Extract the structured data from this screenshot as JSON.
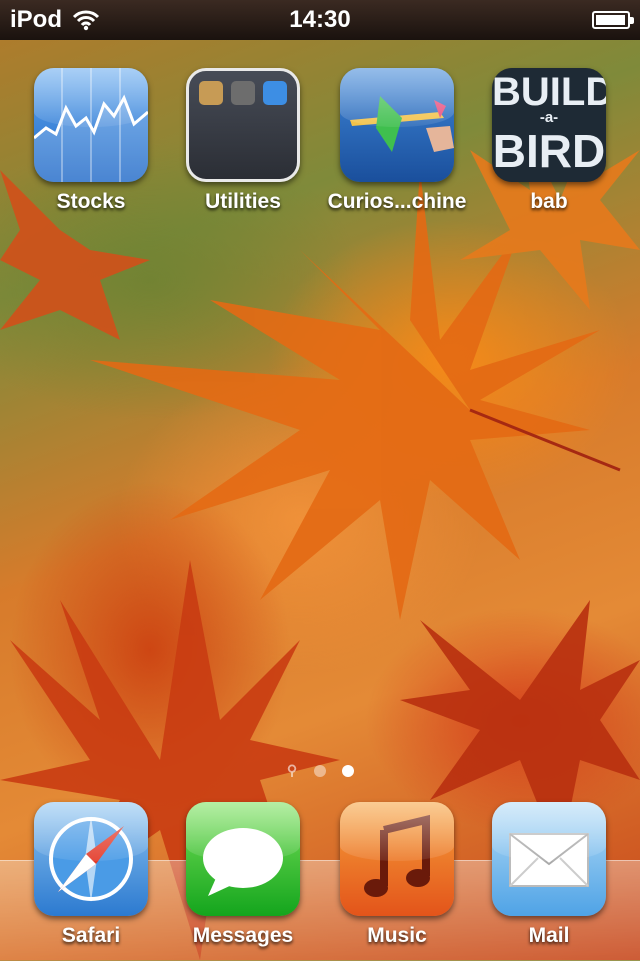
{
  "status_bar": {
    "carrier": "iPod",
    "time": "14:30",
    "battery_level": 0.95
  },
  "home_apps": [
    {
      "label": "Stocks",
      "icon": "stocks-icon"
    },
    {
      "label": "Utilities",
      "icon": "utilities-folder-icon"
    },
    {
      "label": "Curios...chine",
      "icon": "curios-machine-icon"
    },
    {
      "label": "bab",
      "icon": "build-a-bird-icon"
    }
  ],
  "bab_icon_text": {
    "line1": "BUILD",
    "line2": "-a-",
    "line3": "BIRD"
  },
  "page_indicator": {
    "pages": 2,
    "current": 2,
    "spotlight": true
  },
  "dock_apps": [
    {
      "label": "Safari",
      "icon": "safari-icon"
    },
    {
      "label": "Messages",
      "icon": "messages-icon"
    },
    {
      "label": "Music",
      "icon": "music-icon"
    },
    {
      "label": "Mail",
      "icon": "mail-icon"
    }
  ],
  "colors": {
    "statusbar": "#1a120e",
    "accent_orange": "#e3541a"
  }
}
